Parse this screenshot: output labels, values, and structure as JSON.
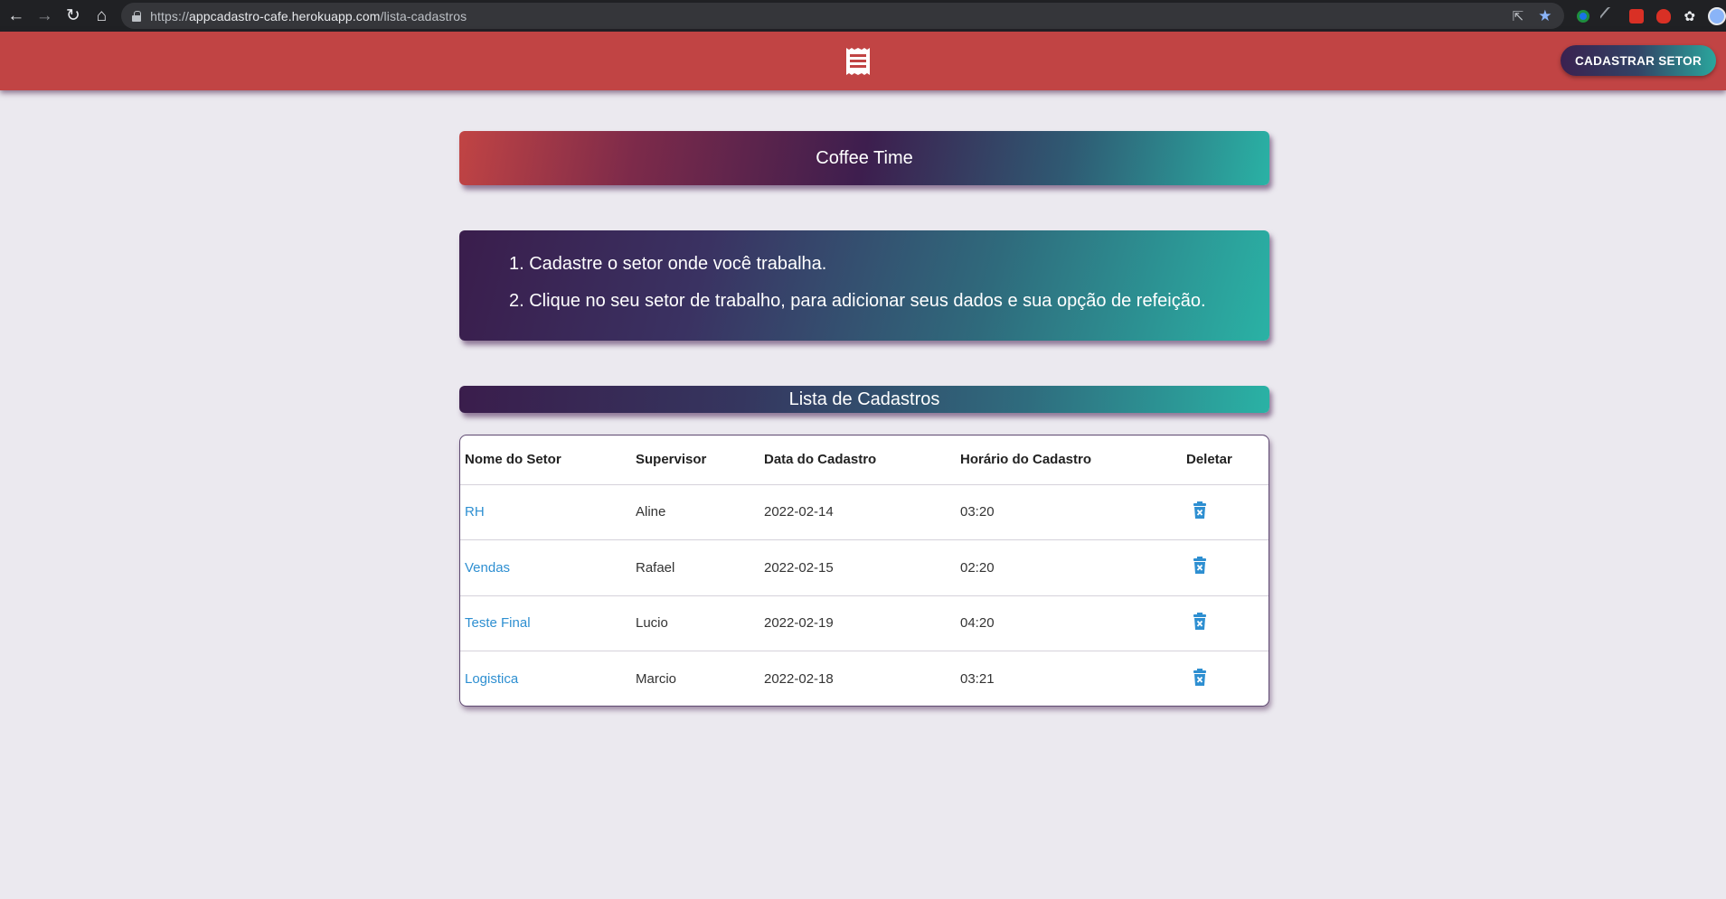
{
  "browser": {
    "url_scheme": "https://",
    "url_host": "appcadastro-cafe.herokuapp.com",
    "url_path": "/lista-cadastros"
  },
  "header": {
    "logo_icon": "receipt-icon",
    "cta_label": "CADASTRAR SETOR",
    "background_color": "#c14444"
  },
  "title_card": {
    "title": "Coffee Time"
  },
  "instructions": {
    "items": [
      "1. Cadastre o setor onde você trabalha.",
      "2. Clique no seu setor de trabalho, para adicionar seus dados e sua opção de refeição."
    ]
  },
  "list_header": {
    "title": "Lista de Cadastros"
  },
  "table": {
    "columns": [
      "Nome do Setor",
      "Supervisor",
      "Data do Cadastro",
      "Horário do Cadastro",
      "Deletar"
    ],
    "rows": [
      {
        "setor": "RH",
        "supervisor": "Aline",
        "data": "2022-02-14",
        "horario": "03:20"
      },
      {
        "setor": "Vendas",
        "supervisor": "Rafael",
        "data": "2022-02-15",
        "horario": "02:20"
      },
      {
        "setor": "Teste Final",
        "supervisor": "Lucio",
        "data": "2022-02-19",
        "horario": "04:20"
      },
      {
        "setor": "Logistica",
        "supervisor": "Marcio",
        "data": "2022-02-18",
        "horario": "03:21"
      }
    ],
    "delete_icon": "trash-icon",
    "link_color": "#2e8fd1"
  }
}
